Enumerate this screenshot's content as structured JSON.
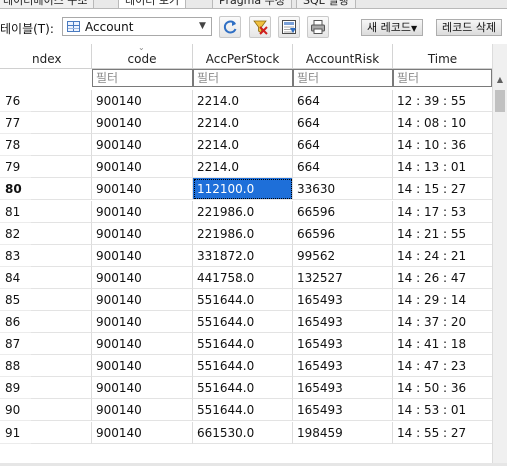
{
  "tabs": [
    {
      "label": "데이터베이스 구조",
      "active": false
    },
    {
      "label": "데이터 보기",
      "active": true
    },
    {
      "label": "Pragma 수정",
      "active": false
    },
    {
      "label": "SQL 실행",
      "active": false
    }
  ],
  "toolbar": {
    "table_label": "테이블(T):",
    "table_value": "Account",
    "new_record_label": "새 레코드",
    "delete_record_label": "레코드 삭제"
  },
  "columns": [
    {
      "label": "ndex"
    },
    {
      "label": "code"
    },
    {
      "label": "AccPerStock"
    },
    {
      "label": "AccountRisk"
    },
    {
      "label": "Time"
    }
  ],
  "filter_placeholder": "필터",
  "selected": {
    "row_number": "80",
    "column": "AccPerStock"
  },
  "rows": [
    {
      "n": "76",
      "code": "900140",
      "acc": "2214.0",
      "risk": "664",
      "time": "12 : 39 : 55"
    },
    {
      "n": "77",
      "code": "900140",
      "acc": "2214.0",
      "risk": "664",
      "time": "14 : 08 : 10"
    },
    {
      "n": "78",
      "code": "900140",
      "acc": "2214.0",
      "risk": "664",
      "time": "14 : 10 : 36"
    },
    {
      "n": "79",
      "code": "900140",
      "acc": "2214.0",
      "risk": "664",
      "time": "14 : 13 : 01"
    },
    {
      "n": "80",
      "code": "900140",
      "acc": "112100.0",
      "risk": "33630",
      "time": "14 : 15 : 27"
    },
    {
      "n": "81",
      "code": "900140",
      "acc": "221986.0",
      "risk": "66596",
      "time": "14 : 17 : 53"
    },
    {
      "n": "82",
      "code": "900140",
      "acc": "221986.0",
      "risk": "66596",
      "time": "14 : 21 : 55"
    },
    {
      "n": "83",
      "code": "900140",
      "acc": "331872.0",
      "risk": "99562",
      "time": "14 : 24 : 21"
    },
    {
      "n": "84",
      "code": "900140",
      "acc": "441758.0",
      "risk": "132527",
      "time": "14 : 26 : 47"
    },
    {
      "n": "85",
      "code": "900140",
      "acc": "551644.0",
      "risk": "165493",
      "time": "14 : 29 : 14"
    },
    {
      "n": "86",
      "code": "900140",
      "acc": "551644.0",
      "risk": "165493",
      "time": "14 : 37 : 20"
    },
    {
      "n": "87",
      "code": "900140",
      "acc": "551644.0",
      "risk": "165493",
      "time": "14 : 41 : 18"
    },
    {
      "n": "88",
      "code": "900140",
      "acc": "551644.0",
      "risk": "165493",
      "time": "14 : 47 : 23"
    },
    {
      "n": "89",
      "code": "900140",
      "acc": "551644.0",
      "risk": "165493",
      "time": "14 : 50 : 36"
    },
    {
      "n": "90",
      "code": "900140",
      "acc": "551644.0",
      "risk": "165493",
      "time": "14 : 53 : 01"
    },
    {
      "n": "91",
      "code": "900140",
      "acc": "661530.0",
      "risk": "198459",
      "time": "14 : 55 : 27"
    }
  ]
}
